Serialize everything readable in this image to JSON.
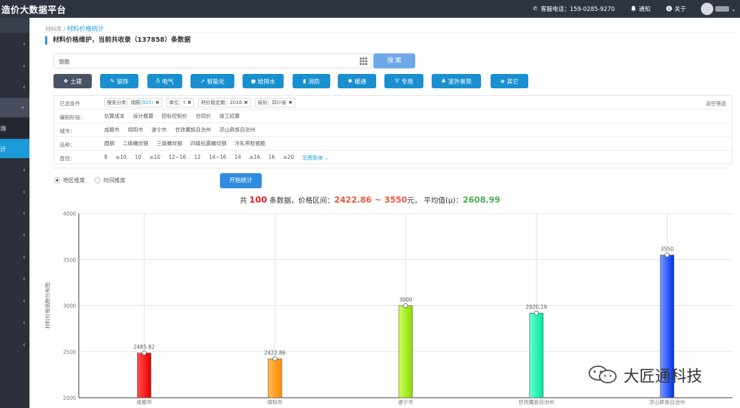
{
  "app": {
    "title": "造价大数据平台"
  },
  "header": {
    "hotline_label": "客服电话：159-0285-9270",
    "notice_label": "通知",
    "about_label": "关于"
  },
  "sidebar": {
    "sub_items": [
      {
        "label": "询"
      },
      {
        "label": "计"
      }
    ]
  },
  "breadcrumb": {
    "parent": "材料库 /",
    "current": "材料价格统计"
  },
  "page_title": "材料价格维护，当前共收录（137858）条数据",
  "search": {
    "value": "钢筋",
    "button_label": "搜 索"
  },
  "categories": [
    {
      "label": "土建",
      "icon": "dropbox-icon"
    },
    {
      "label": "装饰",
      "icon": "brush-icon"
    },
    {
      "label": "电气",
      "icon": "bulb-icon"
    },
    {
      "label": "智能化",
      "icon": "rocket-icon"
    },
    {
      "label": "给排水",
      "icon": "drop-icon"
    },
    {
      "label": "消防",
      "icon": "extinguisher-icon"
    },
    {
      "label": "暖通",
      "icon": "sun-icon"
    },
    {
      "label": "专用",
      "icon": "road-icon"
    },
    {
      "label": "室外景观",
      "icon": "tree-icon"
    },
    {
      "label": "其它",
      "icon": "tag-icon"
    }
  ],
  "filters": {
    "selected": {
      "label": "已选条件",
      "tags": [
        {
          "text": "搜索分类：钢筋",
          "count": "(925)"
        },
        {
          "text": "单位：t",
          "count": ""
        },
        {
          "text": "材价取定期：2016",
          "count": ""
        },
        {
          "text": "省份：四川省",
          "count": ""
        }
      ],
      "clear_label": "清空筛选"
    },
    "stage": {
      "label": "编制阶段：",
      "options": [
        "估算成本",
        "设计概算",
        "招标控制价",
        "合同价",
        "竣工结算"
      ]
    },
    "city": {
      "label": "城市：",
      "options": [
        "成都市",
        "绵阳市",
        "遂宁市",
        "甘孜藏族自治州",
        "凉山彝族自治州"
      ]
    },
    "variety": {
      "label": "品种：",
      "options": [
        "圆钢",
        "二级螺纹钢",
        "三级螺纹钢",
        "四级抗震螺纹钢",
        "冷轧带肋钢筋"
      ]
    },
    "diameter": {
      "label": "直径：",
      "options": [
        "8",
        "≤10",
        "10",
        "≥10",
        "12~16",
        "12",
        "14~16",
        "14",
        "≥16",
        "16",
        "≥20"
      ],
      "range_label": "范围查询"
    }
  },
  "dimension": {
    "region_label": "地区维度",
    "time_label": "时间维度",
    "start_label": "开始统计"
  },
  "summary": {
    "prefix": "共",
    "count": "100",
    "mid": "条数据，价格区间：",
    "range": "2422.86 ~ 3550",
    "unit": "元，",
    "avg_label": "平均值(μ)：",
    "avg": "2608.99"
  },
  "chart_data": {
    "type": "bar",
    "categories": [
      "成都市",
      "绵阳市",
      "遂宁市",
      "甘孜藏族自治州",
      "凉山彝族自治州"
    ],
    "values": [
      2485.82,
      2422.86,
      3000,
      2920.19,
      3550
    ],
    "value_labels": [
      "2485.82",
      "2422.86",
      "3000",
      "2920.19",
      "3550"
    ],
    "ylabel": "材料价格指数分布图",
    "ylim": [
      2000,
      4000
    ],
    "yticks": [
      "2000",
      "2500",
      "3000",
      "3500",
      "4000"
    ],
    "grid": true,
    "bar_colors": [
      [
        "#ff4d4d",
        "#e80000"
      ],
      [
        "#ffbb55",
        "#ff8a00"
      ],
      [
        "#c8ff5a",
        "#88dd00"
      ],
      [
        "#66ffcc",
        "#00e6a0"
      ],
      [
        "#7799ff",
        "#0033ee"
      ]
    ]
  },
  "watermark": {
    "text": "大匠通科技"
  }
}
